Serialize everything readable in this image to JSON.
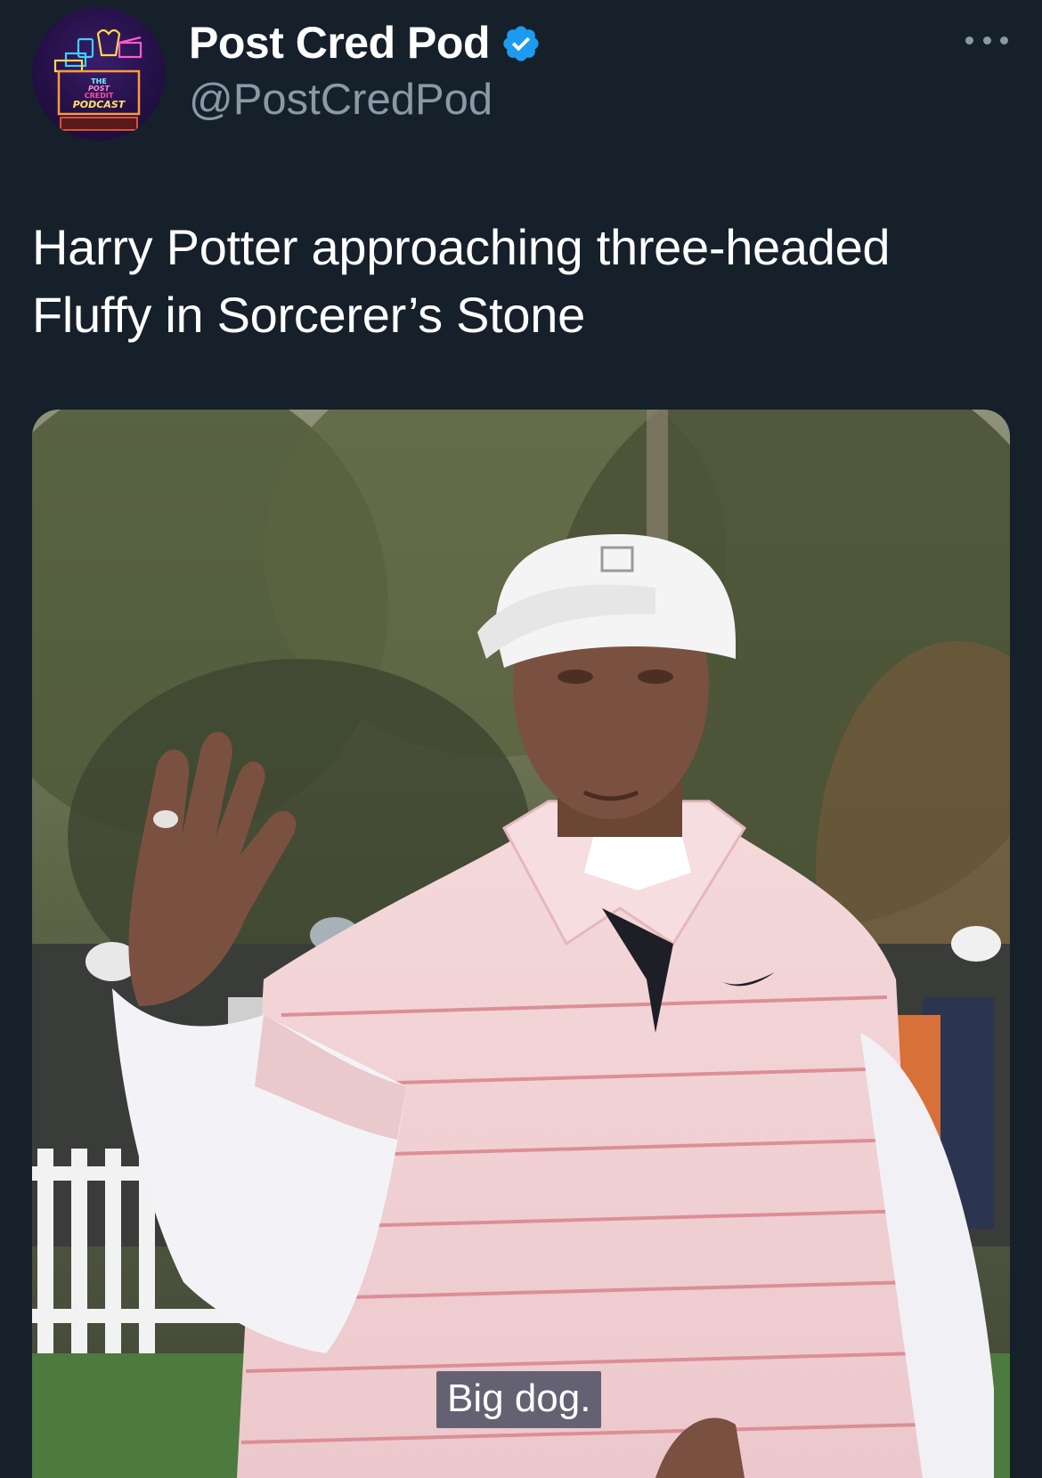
{
  "tweet": {
    "author": {
      "display_name": "Post Cred Pod",
      "handle": "@PostCredPod",
      "verified": true,
      "avatar_text": [
        "THE",
        "POST",
        "CREDIT",
        "PODCAST"
      ]
    },
    "text": "Harry Potter approaching three-headed Fluffy in Sorcerer’s Stone",
    "media": {
      "caption": "Big dog."
    },
    "icons": {
      "verified": "verified-badge-icon",
      "more": "more-options-icon"
    },
    "colors": {
      "background": "#15202b",
      "handle": "#8b98a5",
      "verified": "#1d9bf0"
    }
  }
}
